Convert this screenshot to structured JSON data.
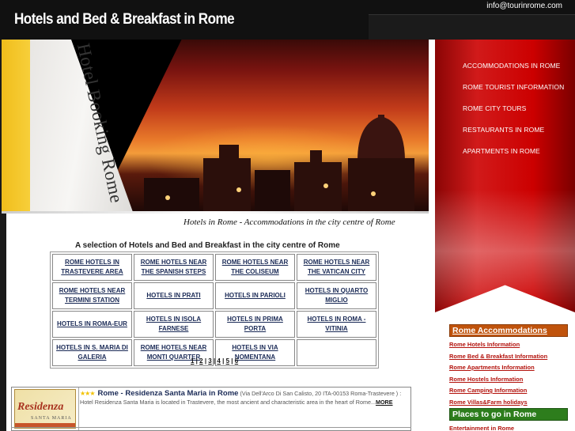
{
  "header": {
    "title": "Hotels and Bed & Breakfast in Rome",
    "email": "info@tourinrome.com"
  },
  "banner": {
    "vertical_text": "Hotel Booking Rome",
    "caption": "Hotels in Rome - Accommodations in the city centre of Rome"
  },
  "right_menu": [
    "ACCOMMODATIONS IN ROME",
    "ROME TOURIST INFORMATION",
    "ROME CITY TOURS",
    "RESTAURANTS IN ROME",
    "APARTMENTS IN ROME"
  ],
  "side": {
    "accommodations_head": "Rome Accommodations",
    "accommodations": [
      "Rome Hotels Information",
      "Rome Bed & Breakfast Information",
      "Rome Apartments Information",
      "Rome Hostels Information",
      "Rome Camping Information",
      "Rome Villas&Farm holidays"
    ],
    "places_head": "Places to go in Rome",
    "places": [
      "Entertainment in Rome"
    ]
  },
  "main": {
    "section_title": "A selection of Hotels and Bed and Breakfast in the city centre of Rome",
    "grid": [
      [
        "ROME HOTELS IN TRASTEVERE AREA",
        "ROME HOTELS NEAR THE SPANISH STEPS",
        "ROME HOTELS NEAR THE COLISEUM",
        "ROME HOTELS NEAR THE VATICAN CITY"
      ],
      [
        "ROME HOTELS NEAR TERMINI STATION",
        "HOTELS IN PRATI",
        "HOTELS IN PARIOLI",
        "HOTELS IN QUARTO MIGLIO"
      ],
      [
        "HOTELS IN ROMA-EUR",
        "HOTELS IN ISOLA FARNESE",
        "HOTELS IN PRIMA PORTA",
        "HOTELS IN ROMA - VITINIA"
      ],
      [
        "HOTELS IN S. MARIA DI GALERIA",
        "ROME HOTELS NEAR MONTI QUARTER",
        "HOTELS IN VIA NOMENTANA",
        ""
      ]
    ],
    "pager": [
      "1",
      "2",
      "3",
      "4",
      "5",
      "6"
    ]
  },
  "listing": {
    "stars": "★★★",
    "name": "Rome - Residenza Santa Maria in Rome",
    "address": "(Via Dell'Arco Di San Calisto, 20 ITA-00153 Roma-Trastevere )",
    "description": ": Hotel Residenza Santa Maria is located in Trastevere, the most ancient and characteristic area in the heart of Rome...",
    "more": "MORE",
    "thumb_title": "Residenza",
    "thumb_sub": "SANTA MARIA"
  },
  "colors": {
    "header_bg": "#111111",
    "right_column_red": "#cc0000",
    "link_blue": "#1a2a56",
    "side_orange": "#c0530c",
    "side_green": "#2d7d1c",
    "sunset_orange": "#e8792a"
  }
}
